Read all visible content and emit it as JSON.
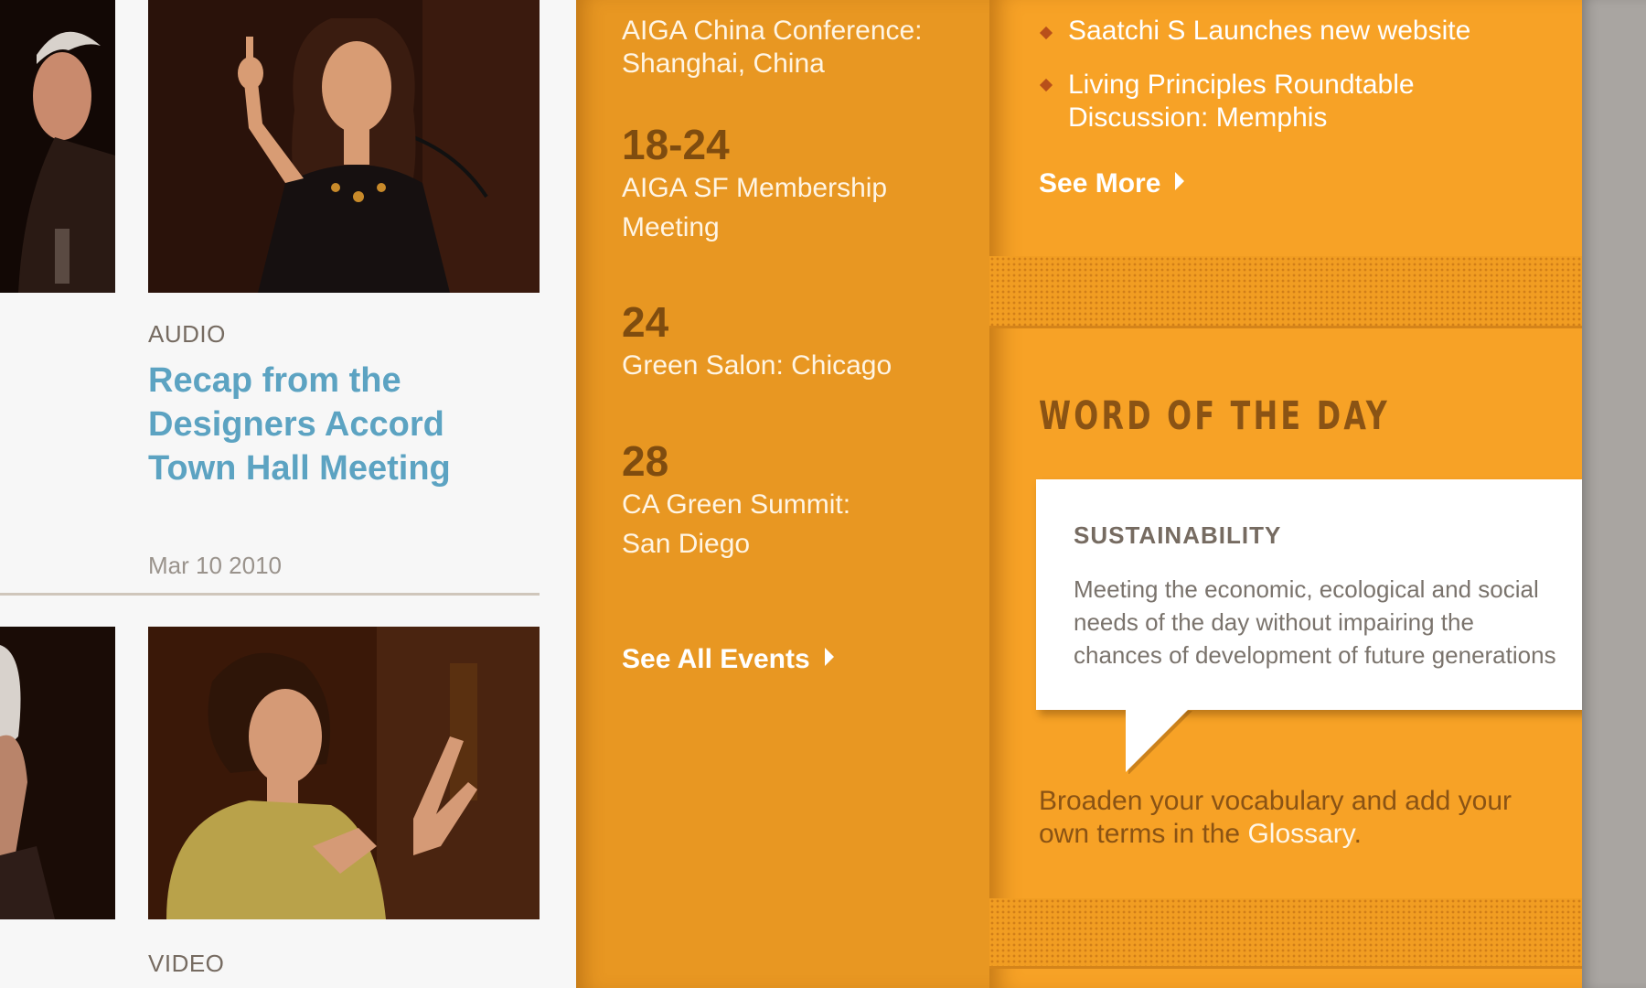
{
  "articles": [
    {
      "kicker": "AUDIO",
      "title": [
        "Recap from the",
        "Designers Accord",
        "Town Hall Meeting"
      ],
      "date": "Mar 10 2010"
    },
    {
      "kicker": "VIDEO"
    }
  ],
  "events": {
    "items": [
      {
        "day": "",
        "title": [
          "AIGA China Conference:",
          "Shanghai, China"
        ]
      },
      {
        "day": "18-24",
        "title": [
          "AIGA SF Membership",
          "Meeting"
        ]
      },
      {
        "day": "24",
        "title": [
          "Green Salon: Chicago"
        ]
      },
      {
        "day": "28",
        "title": [
          "CA Green Summit:",
          "San Diego"
        ]
      }
    ],
    "see_all_label": "See All Events"
  },
  "news": {
    "items": [
      [
        "Saatchi S Launches new website"
      ],
      [
        "Living Principles Roundtable",
        "Discussion: Memphis"
      ]
    ],
    "see_more_label": "See More"
  },
  "word_of_the_day": {
    "heading": "WORD OF THE DAY",
    "term": "SUSTAINABILITY",
    "definition": [
      "Meeting the economic, ecological and social",
      "needs of the day without impairing the",
      "chances of development of future generations"
    ],
    "glossary_line1": "Broaden your vocabulary and add your",
    "glossary_line2_pre": "own terms in the ",
    "glossary_link": "Glossary",
    "glossary_line2_post": "."
  },
  "colors": {
    "events_bg": "#e89722",
    "news_bg": "#f7a226",
    "link_blue": "#5ca3c2",
    "heading_brown": "#8a5314"
  }
}
